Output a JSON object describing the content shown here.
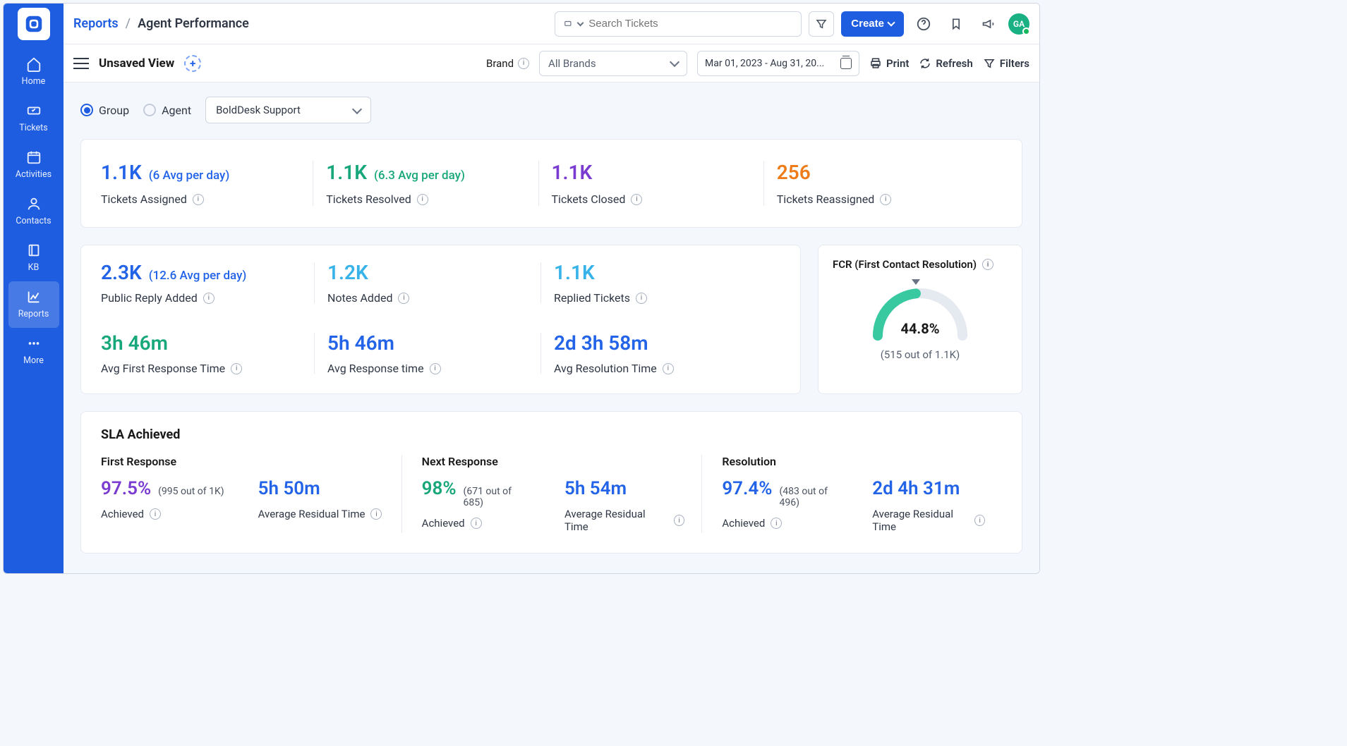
{
  "sidebar": {
    "items": [
      {
        "label": "Home"
      },
      {
        "label": "Tickets"
      },
      {
        "label": "Activities"
      },
      {
        "label": "Contacts"
      },
      {
        "label": "KB"
      },
      {
        "label": "Reports"
      },
      {
        "label": "More"
      }
    ]
  },
  "topbar": {
    "breadcrumb_root": "Reports",
    "breadcrumb_current": "Agent Performance",
    "search_placeholder": "Search Tickets",
    "create_label": "Create",
    "avatar_initials": "GA"
  },
  "subbar": {
    "view_title": "Unsaved View",
    "brand_label": "Brand",
    "brand_value": "All Brands",
    "date_range": "Mar 01, 2023 - Aug 31, 20...",
    "print_label": "Print",
    "refresh_label": "Refresh",
    "filters_label": "Filters"
  },
  "filterbar": {
    "radio_group": "Group",
    "radio_agent": "Agent",
    "support_selected": "BoldDesk Support"
  },
  "metrics_top": [
    {
      "value": "1.1K",
      "avg": "(6 Avg per day)",
      "label": "Tickets Assigned",
      "color": "c-blue"
    },
    {
      "value": "1.1K",
      "avg": "(6.3 Avg per day)",
      "label": "Tickets Resolved",
      "color": "c-green"
    },
    {
      "value": "1.1K",
      "avg": "",
      "label": "Tickets Closed",
      "color": "c-purple"
    },
    {
      "value": "256",
      "avg": "",
      "label": "Tickets Reassigned",
      "color": "c-orange"
    }
  ],
  "metrics_mid": [
    {
      "value": "2.3K",
      "avg": "(12.6 Avg per day)",
      "label": "Public Reply Added",
      "color": "c-blue"
    },
    {
      "value": "1.2K",
      "avg": "",
      "label": "Notes Added",
      "color": "c-cyan"
    },
    {
      "value": "1.1K",
      "avg": "",
      "label": "Replied Tickets",
      "color": "c-cyan"
    },
    {
      "value": "3h 46m",
      "avg": "",
      "label": "Avg First Response Time",
      "color": "c-green"
    },
    {
      "value": "5h 46m",
      "avg": "",
      "label": "Avg Response time",
      "color": "c-blue"
    },
    {
      "value": "2d 3h 58m",
      "avg": "",
      "label": "Avg Resolution Time",
      "color": "c-blue"
    }
  ],
  "fcr": {
    "title": "FCR (First Contact Resolution)",
    "percent": "44.8%",
    "sub": "(515 out of 1.1K)"
  },
  "sla": {
    "title": "SLA Achieved",
    "columns": [
      {
        "heading": "First Response",
        "pct": "97.5%",
        "pct_sub": "(995 out of 1K)",
        "time": "5h 50m",
        "achieved_label": "Achieved",
        "residual_label": "Average Residual Time",
        "pct_color": "c-purple",
        "time_color": "c-blue"
      },
      {
        "heading": "Next Response",
        "pct": "98%",
        "pct_sub": "(671 out of 685)",
        "time": "5h 54m",
        "achieved_label": "Achieved",
        "residual_label": "Average Residual Time",
        "pct_color": "c-green",
        "time_color": "c-blue"
      },
      {
        "heading": "Resolution",
        "pct": "97.4%",
        "pct_sub": "(483 out of 496)",
        "time": "2d 4h 31m",
        "achieved_label": "Achieved",
        "residual_label": "Average Residual Time",
        "pct_color": "c-blue",
        "time_color": "c-blue"
      }
    ]
  },
  "chart_data": {
    "type": "gauge",
    "title": "FCR (First Contact Resolution)",
    "value_percent": 44.8,
    "count": 515,
    "total": "1.1K",
    "range": [
      0,
      100
    ]
  }
}
